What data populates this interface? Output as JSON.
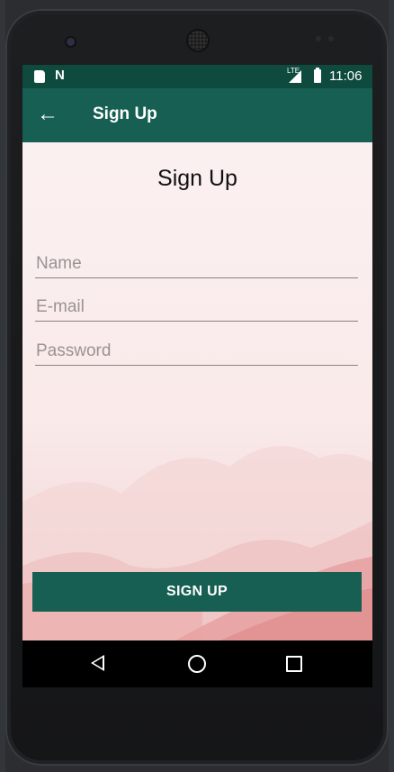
{
  "status_bar": {
    "time": "11:06",
    "network": "LTE",
    "icons": [
      "sd-card-icon",
      "n-notification-icon",
      "signal-icon",
      "battery-charging-icon"
    ]
  },
  "app_bar": {
    "title": "Sign Up",
    "back_icon": "arrow-back-icon"
  },
  "form": {
    "heading": "Sign Up",
    "name_placeholder": "Name",
    "email_placeholder": "E-mail",
    "password_placeholder": "Password",
    "submit_label": "SIGN UP"
  },
  "nav_bar": {
    "icons": [
      "nav-back-icon",
      "nav-home-icon",
      "nav-recents-icon"
    ]
  },
  "colors": {
    "primary": "#165f52",
    "primary_dark": "#0f4a3e",
    "background": "#fbeeee"
  }
}
